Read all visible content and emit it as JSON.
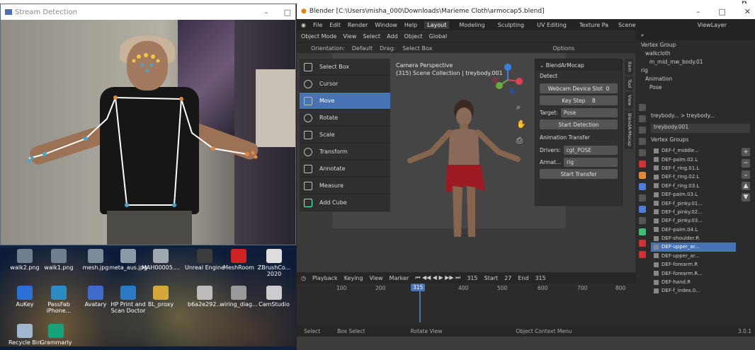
{
  "stream": {
    "title": "Stream Detection",
    "win_min": "–",
    "win_max": "□"
  },
  "desktop_icons": [
    {
      "label": "walk2.png",
      "color": "#6f7f8f"
    },
    {
      "label": "walk1.png",
      "color": "#6f7f8f"
    },
    {
      "label": "mesh.jpg",
      "color": "#7a8b9a"
    },
    {
      "label": "meta_aus.jpg",
      "color": "#8a9aa8"
    },
    {
      "label": "MAH00005....",
      "color": "#a0a8b0"
    },
    {
      "label": "Unreal Engine",
      "color": "#3b3b3b"
    },
    {
      "label": "MeshRoom",
      "color": "#c22"
    },
    {
      "label": "ZBrushCo... 2020",
      "color": "#ddd"
    },
    {
      "label": "AuKey",
      "color": "#2a6fd6"
    },
    {
      "label": "PassFab iPhone...",
      "color": "#2a8cc2"
    },
    {
      "label": "Avatary",
      "color": "#3d6acb"
    },
    {
      "label": "HP Print and Scan Doctor",
      "color": "#2b78c4"
    },
    {
      "label": "BL_proxy",
      "color": "#d4a73a"
    },
    {
      "label": "b6a2e292...",
      "color": "#bbb"
    },
    {
      "label": "wiring_diag...",
      "color": "#999"
    },
    {
      "label": "CamStudio",
      "color": "#ccc"
    },
    {
      "label": "Recycle Bin",
      "color": "#9fb6cf"
    },
    {
      "label": "Grammarly",
      "color": "#16a37a"
    }
  ],
  "blender": {
    "title": "Blender [C:\\Users\\misha_000\\Downloads\\Marieme Cloth\\armocap5.blend]",
    "menu": [
      "File",
      "Edit",
      "Render",
      "Window",
      "Help"
    ],
    "workspaces": [
      "Layout",
      "Modeling",
      "Sculpting",
      "UV Editing",
      "Texture Pa"
    ],
    "scene": "Scene",
    "view_layer": "ViewLayer",
    "header": [
      "Object Mode",
      "View",
      "Select",
      "Add",
      "Object",
      "Global"
    ],
    "header2": [
      "Orientation:",
      "Default",
      "Drag:",
      "Select Box",
      "Options"
    ],
    "tools": [
      "Select Box",
      "Cursor",
      "Move",
      "Rotate",
      "Scale",
      "Transform",
      "Annotate",
      "Measure",
      "Add Cube"
    ],
    "active_tool": "Move",
    "viewport_label_1": "Camera Perspective",
    "viewport_label_2": "(315) Scene Collection | treybody.001",
    "mocap": {
      "title": "BlendArMocap",
      "detect": "Detect",
      "webcam_label": "Webcam Device Slot",
      "webcam_val": "0",
      "keystep_label": "Key Step",
      "keystep_val": "8",
      "target_label": "Target:",
      "target_val": "Pose",
      "start_detect": "Start Detection",
      "anim_transfer": "Animation Transfer",
      "drivers_label": "Drivers:",
      "drivers_val": "cgt_POSE",
      "armat_label": "Armat...",
      "armat_val": "rig",
      "start_transfer": "Start Transfer"
    },
    "vtabs": [
      "Item",
      "Tool",
      "View",
      "BlendArMocap"
    ],
    "timeline": {
      "playback": "Playback",
      "keying": "Keying",
      "view": "View",
      "marker": "Marker",
      "frame": "315",
      "start_label": "Start",
      "start": "27",
      "end_label": "End",
      "end": "315"
    },
    "ruler": [
      "100",
      "200",
      "400",
      "500",
      "600",
      "700",
      "800"
    ],
    "playhead": "315",
    "status": [
      "Select",
      "Box Select",
      "Rotate View",
      "Object Context Menu"
    ],
    "status_right": "3.0.1",
    "outliner": [
      "Vertex Group",
      "walkcloth",
      "m_mid_mw_body.01",
      "rig",
      "Animation",
      "Pose"
    ],
    "props_breadcrumb": "treybody... > treybody...",
    "props_object": "treybody.001",
    "vertex_groups_title": "Vertex Groups",
    "vertex_groups": [
      "DEF-f_middle...",
      "DEF-palm.02.L",
      "DEF-f_ring.01.L",
      "DEF-f_ring.02.L",
      "DEF-f_ring.03.L",
      "DEF-palm.03.L",
      "DEF-f_pinky.01...",
      "DEF-f_pinky.02...",
      "DEF-f_pinky.03...",
      "DEF-palm.04.L",
      "DEF-shoulder.R",
      "DEF-upper_ar...",
      "DEF-upper_ar...",
      "DEF-forearm.R",
      "DEF-forearm.R...",
      "DEF-hand.R",
      "DEF-f_index.0..."
    ],
    "selected_vg": 11
  }
}
